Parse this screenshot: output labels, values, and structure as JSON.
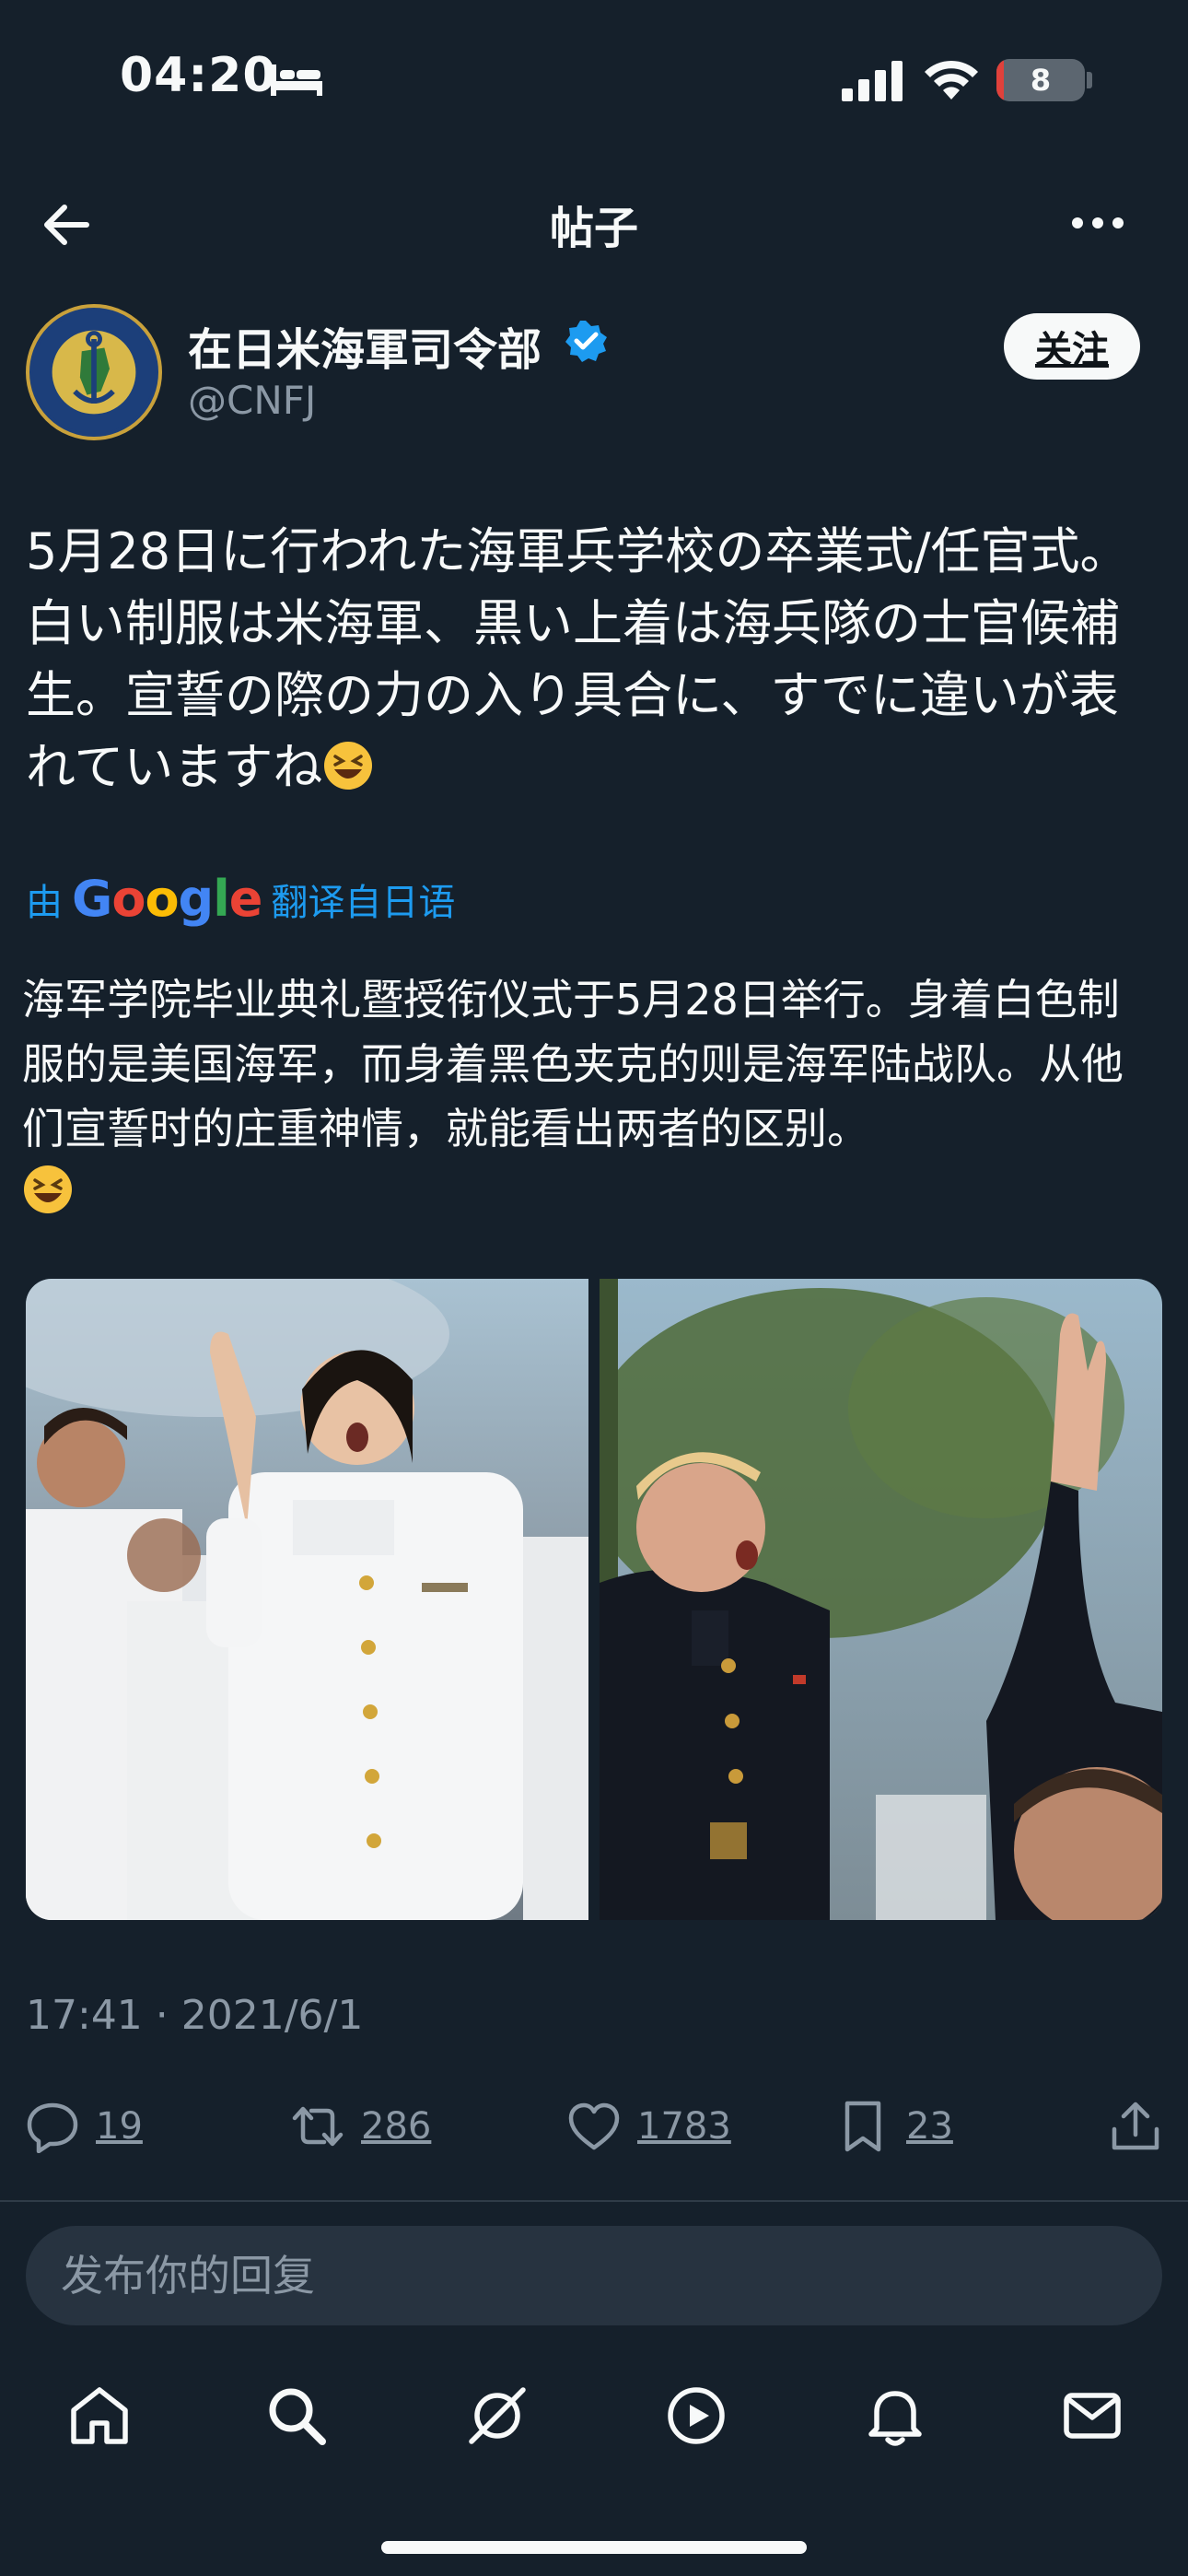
{
  "status_bar": {
    "time": "04:20",
    "battery": "8",
    "battery_fraction": 0.08
  },
  "header": {
    "title": "帖子"
  },
  "author": {
    "name": "在日米海軍司令部",
    "handle": "@CNFJ",
    "follow_label": "关注"
  },
  "post": {
    "text": "5月28日に行われた海軍兵学校の卒業式/任官式。白い制服は米海軍、黒い上着は海兵隊の士官候補生。宣誓の際の力の入り具合に、すでに違いが表れていますね",
    "translate_prefix": "由",
    "translate_brand": "Google",
    "translate_suffix": "翻译自日语",
    "translation": "海军学院毕业典礼暨授衔仪式于5月28日举行。身着白色制服的是美国海军，而身着黑色夹克的则是海军陆战队。从他们宣誓时的庄重神情，就能看出两者的区别。",
    "timestamp": "17:41 · 2021/6/1"
  },
  "actions": {
    "replies": "19",
    "retweets": "286",
    "likes": "1783",
    "bookmarks": "23"
  },
  "reply_box": {
    "placeholder": "发布你的回复"
  },
  "colors": {
    "background": "#15202b",
    "accent": "#1d9bf0",
    "muted": "#8b98a5"
  }
}
